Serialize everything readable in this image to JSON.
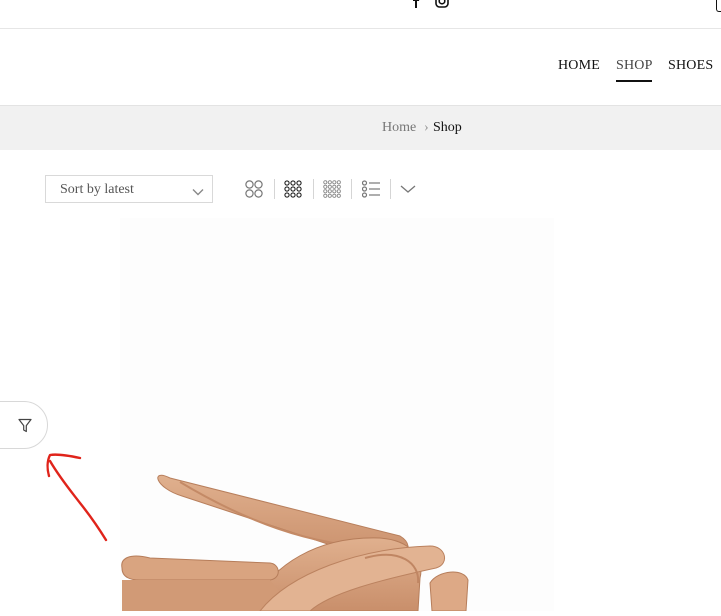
{
  "header": {
    "social": [
      {
        "icon": "facebook-icon"
      },
      {
        "icon": "instagram-icon"
      }
    ]
  },
  "nav": {
    "items": [
      {
        "label": "HOME",
        "active": false
      },
      {
        "label": "SHOP",
        "active": true
      },
      {
        "label": "SHOES",
        "active": false
      }
    ]
  },
  "breadcrumb": {
    "home": "Home",
    "separator": "›",
    "current": "Shop"
  },
  "toolbar": {
    "sort_label": "Sort by latest",
    "views": [
      "grid-2-icon",
      "grid-3-icon",
      "grid-4-icon",
      "list-icon",
      "chevron-down-icon"
    ]
  },
  "filter": {
    "icon": "filter-icon"
  },
  "colors": {
    "breadcrumb_bg": "#f1f1f1",
    "product_tan": "#d7a27f",
    "annotation_red": "#e0241b"
  }
}
